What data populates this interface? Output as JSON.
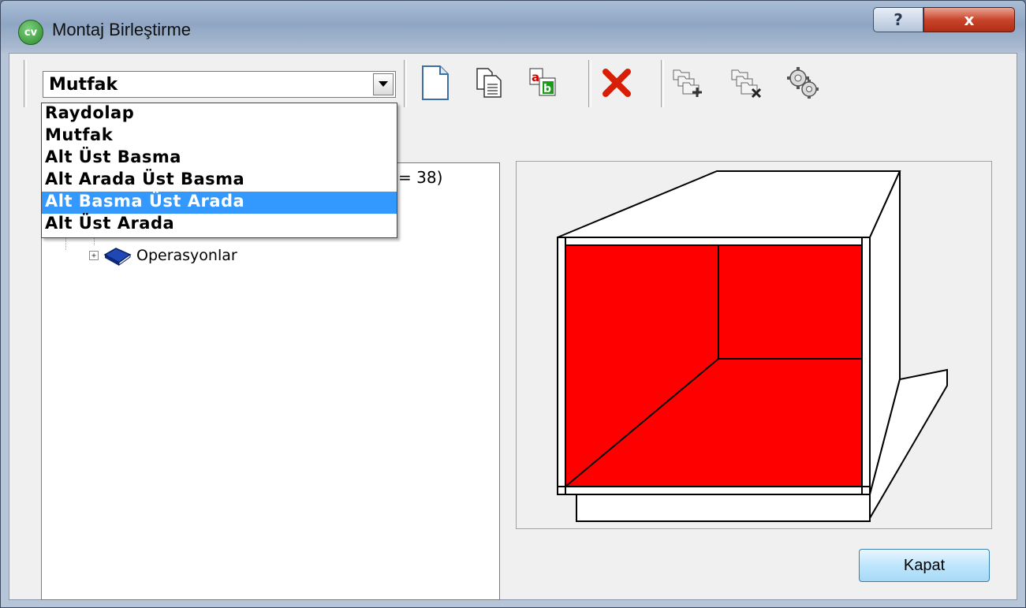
{
  "window": {
    "title": "Montaj Birleştirme",
    "icon_text": "cv",
    "help_label": "?",
    "close_label": "x"
  },
  "toolbar": {
    "combo_value": "Mutfak",
    "icons": [
      "new-document-icon",
      "copy-document-icon",
      "rename-icon",
      "delete-icon",
      "add-folder-icon",
      "remove-folder-icon",
      "settings-gears-icon"
    ]
  },
  "dropdown": {
    "items": [
      "Raydolap",
      "Mutfak",
      "Alt Üst Basma",
      "Alt Arada Üst Basma",
      "Alt Basma Üst Arada",
      "Alt Üst Arada"
    ],
    "selected_index": 4
  },
  "tree": {
    "partial_text": "= 38)",
    "node_expander": "+",
    "node_label": "Operasyonlar"
  },
  "footer": {
    "close_button_label": "Kapat"
  },
  "colors": {
    "selection": "#3399ff",
    "cabinet_interior": "#ff0000"
  }
}
